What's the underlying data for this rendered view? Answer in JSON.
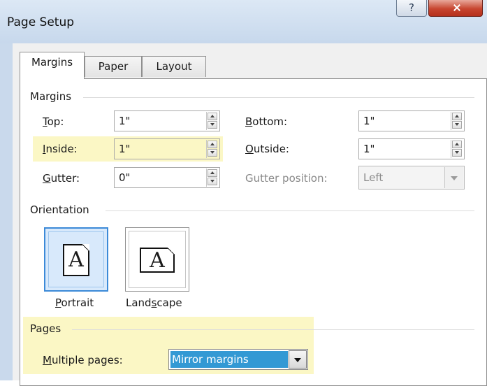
{
  "window": {
    "title": "Page Setup",
    "help_label": "?",
    "close_label": ""
  },
  "tabs": [
    {
      "label": "Margins",
      "active": true
    },
    {
      "label": "Paper",
      "active": false
    },
    {
      "label": "Layout",
      "active": false
    }
  ],
  "margins": {
    "section_label": "Margins",
    "top": {
      "label": "Top:",
      "value": "1\""
    },
    "bottom": {
      "label": "Bottom:",
      "value": "1\""
    },
    "inside": {
      "label": "Inside:",
      "value": "1\""
    },
    "outside": {
      "label": "Outside:",
      "value": "1\""
    },
    "gutter": {
      "label": "Gutter:",
      "value": "0\""
    },
    "gutter_position": {
      "label": "Gutter position:",
      "value": "Left"
    }
  },
  "orientation": {
    "section_label": "Orientation",
    "portrait_label": "Portrait",
    "landscape_label": "Landscape",
    "doc_glyph": "A"
  },
  "pages": {
    "section_label": "Pages",
    "multiple_label": "Multiple pages:",
    "multiple_value": "Mirror margins"
  },
  "colors": {
    "highlight": "#fbf7c5",
    "selection": "#3399d4",
    "close_red": "#c7452f"
  }
}
